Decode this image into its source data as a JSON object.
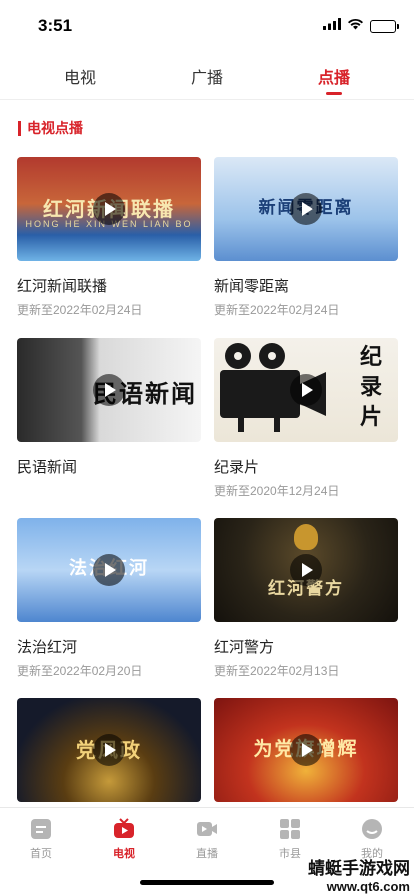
{
  "status_bar": {
    "time": "3:51"
  },
  "top_tabs": [
    {
      "label": "电视",
      "active": false
    },
    {
      "label": "广播",
      "active": false
    },
    {
      "label": "点播",
      "active": true
    }
  ],
  "section": {
    "title": "电视点播"
  },
  "programs": [
    {
      "title": "红河新闻联播",
      "updated": "更新至2022年02月24日",
      "thumb_text": "红河新闻联播",
      "thumb_sub": "HONG HE XIN WEN LIAN BO"
    },
    {
      "title": "新闻零距离",
      "updated": "更新至2022年02月24日",
      "thumb_text": "新闻零距离"
    },
    {
      "title": "民语新闻",
      "updated": "",
      "thumb_text": "民语新闻"
    },
    {
      "title": "纪录片",
      "updated": "更新至2020年12月24日",
      "thumb_text": "纪录片"
    },
    {
      "title": "法治红河",
      "updated": "更新至2022年02月20日",
      "thumb_text": "法治红河"
    },
    {
      "title": "红河警方",
      "updated": "更新至2022年02月13日",
      "thumb_text": "红河警方"
    },
    {
      "title": "",
      "updated": "",
      "thumb_text": "党风政"
    },
    {
      "title": "",
      "updated": "",
      "thumb_text": "为党旗增辉"
    }
  ],
  "bottom_nav": [
    {
      "label": "首页",
      "icon": "home-icon",
      "active": false
    },
    {
      "label": "电视",
      "icon": "tv-icon",
      "active": true
    },
    {
      "label": "直播",
      "icon": "live-video-icon",
      "active": false
    },
    {
      "label": "市县",
      "icon": "grid-icon",
      "active": false
    },
    {
      "label": "我的",
      "icon": "profile-icon",
      "active": false
    }
  ],
  "watermark": {
    "line1": "蜻蜓手游戏网",
    "line2": "www.qt6.com"
  },
  "colors": {
    "accent": "#d8232a",
    "muted": "#999999"
  }
}
